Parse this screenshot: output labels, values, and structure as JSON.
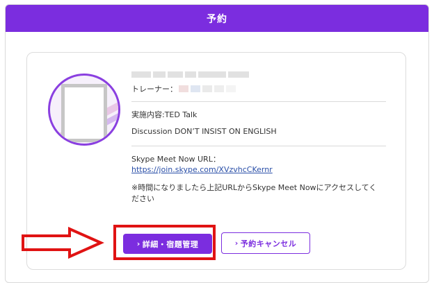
{
  "panel": {
    "title": "予約"
  },
  "reservation": {
    "datetime_label": "2021/0?/?? (?) 22:00 - 22:30",
    "trainer_label": "トレーナー：",
    "content_label": "実施内容:TED Talk",
    "discussion": "Discussion DON’T INSIST ON ENGLISH",
    "skype_label": "Skype Meet Now URL：",
    "skype_url": "https://join.skype.com/XVzvhcCKernr",
    "note": "※時間になりましたら上記URLからSkype Meet Nowにアクセスしてください"
  },
  "buttons": {
    "details_label": "詳細・宿題管理",
    "cancel_label": "予約キャンセル",
    "chevron": "›"
  },
  "colors": {
    "accent": "#7b2ddf",
    "highlight": "#e01313",
    "link": "#2a4fa8"
  },
  "icons": {
    "avatar": "trainer-avatar",
    "arrow": "right-arrow-annotation"
  }
}
